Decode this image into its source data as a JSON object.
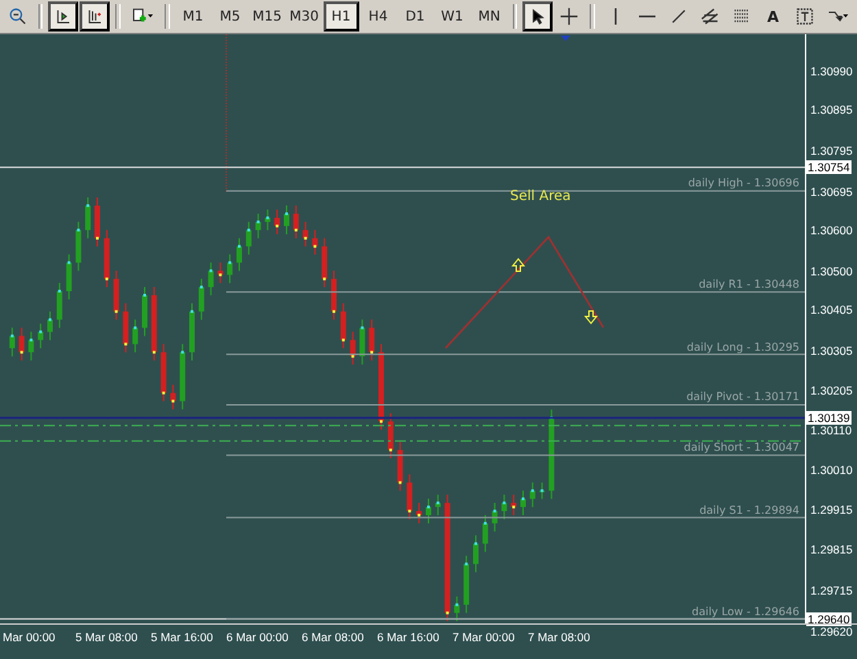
{
  "toolbar": {
    "tools": [
      {
        "kind": "zoom-out",
        "pressed": false
      },
      {
        "kind": "autoscroll",
        "pressed": true
      },
      {
        "kind": "chart-shift",
        "pressed": true
      },
      {
        "kind": "new-chart",
        "pressed": false
      }
    ],
    "periods": [
      {
        "label": "M1",
        "selected": false
      },
      {
        "label": "M5",
        "selected": false
      },
      {
        "label": "M15",
        "selected": false
      },
      {
        "label": "M30",
        "selected": false
      },
      {
        "label": "H1",
        "selected": true
      },
      {
        "label": "H4",
        "selected": false
      },
      {
        "label": "D1",
        "selected": false
      },
      {
        "label": "W1",
        "selected": false
      },
      {
        "label": "MN",
        "selected": false
      }
    ],
    "drawing_tools": [
      {
        "kind": "cursor",
        "pressed": true
      },
      {
        "kind": "crosshair",
        "pressed": false
      },
      {
        "kind": "vline",
        "pressed": false
      },
      {
        "kind": "hline",
        "pressed": false
      },
      {
        "kind": "trendline",
        "pressed": false
      },
      {
        "kind": "channel",
        "pressed": false
      },
      {
        "kind": "fibo",
        "pressed": false
      },
      {
        "kind": "text",
        "label": "A",
        "pressed": false
      },
      {
        "kind": "label",
        "pressed": false
      },
      {
        "kind": "arrows",
        "pressed": false
      }
    ]
  },
  "chart": {
    "annotation": "Sell Area",
    "levels": [
      "daily High - 1.30696",
      "daily R1 - 1.30448",
      "daily Long - 1.30295",
      "daily Pivot - 1.30171",
      "daily Short - 1.30047",
      "daily S1 - 1.29894",
      "daily Low - 1.29646"
    ],
    "price_axis": [
      "1.30990",
      "1.30895",
      "1.30795",
      "1.30695",
      "1.30600",
      "1.30500",
      "1.30405",
      "1.30305",
      "1.30205",
      "1.30110",
      "1.30010",
      "1.29915",
      "1.29815",
      "1.29715",
      "1.29620"
    ],
    "price_markers": [
      "1.30754",
      "1.30139",
      "1.29640"
    ],
    "time_axis": [
      "Mar 00:00",
      "5 Mar 08:00",
      "5 Mar 16:00",
      "6 Mar 00:00",
      "6 Mar 08:00",
      "6 Mar 16:00",
      "7 Mar 00:00",
      "7 Mar 08:00"
    ]
  }
}
